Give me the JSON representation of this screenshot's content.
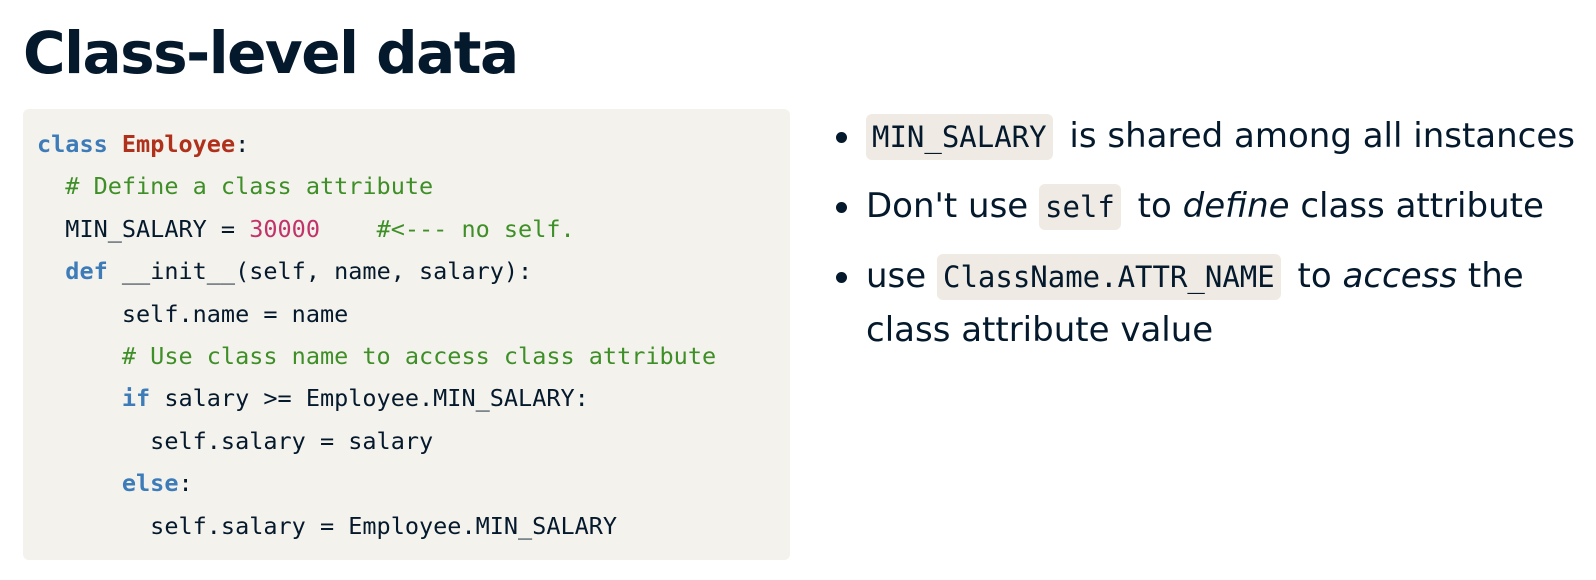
{
  "page": {
    "title": "Class-level data"
  },
  "code": {
    "lines": [
      [
        {
          "t": "class",
          "k": "kw"
        },
        {
          "t": " ",
          "k": ""
        },
        {
          "t": "Employee",
          "k": "cls"
        },
        {
          "t": ":",
          "k": ""
        }
      ],
      [
        {
          "t": "  ",
          "k": ""
        },
        {
          "t": "# Define a class attribute",
          "k": "cm"
        }
      ],
      [
        {
          "t": "  MIN_SALARY = ",
          "k": ""
        },
        {
          "t": "30000",
          "k": "num"
        },
        {
          "t": "    ",
          "k": ""
        },
        {
          "t": "#<--- no self.",
          "k": "cm"
        }
      ],
      [
        {
          "t": "  ",
          "k": ""
        },
        {
          "t": "def",
          "k": "kw"
        },
        {
          "t": " __init__(self, name, salary):",
          "k": ""
        }
      ],
      [
        {
          "t": "      self.name = name",
          "k": ""
        }
      ],
      [
        {
          "t": "      ",
          "k": ""
        },
        {
          "t": "# Use class name to access class attribute",
          "k": "cm"
        }
      ],
      [
        {
          "t": "      ",
          "k": ""
        },
        {
          "t": "if",
          "k": "kw"
        },
        {
          "t": " salary >= Employee.MIN_SALARY:",
          "k": ""
        }
      ],
      [
        {
          "t": "        self.salary = salary",
          "k": ""
        }
      ],
      [
        {
          "t": "      ",
          "k": ""
        },
        {
          "t": "else",
          "k": "kw"
        },
        {
          "t": ":",
          "k": ""
        }
      ],
      [
        {
          "t": "        self.salary = Employee.MIN_SALARY",
          "k": ""
        }
      ]
    ]
  },
  "bullets": [
    {
      "code1": "MIN_SALARY",
      "text1": " is shared among all instances"
    },
    {
      "pre": "Don't use ",
      "code1": "self",
      "text1": " to ",
      "em1": "define",
      "text2": " class attribute"
    },
    {
      "pre": "use ",
      "code1": "ClassName.ATTR_NAME",
      "text1": " to ",
      "em1": "access",
      "text2": " the class attribute value"
    }
  ],
  "colors": {
    "title": "#05192d",
    "code_background": "#f4f2ec",
    "keyword": "#3d7cb8",
    "class_name": "#b0311b",
    "comment": "#3e8f27",
    "number": "#c1336a",
    "inline_code_background": "#efebe4"
  }
}
